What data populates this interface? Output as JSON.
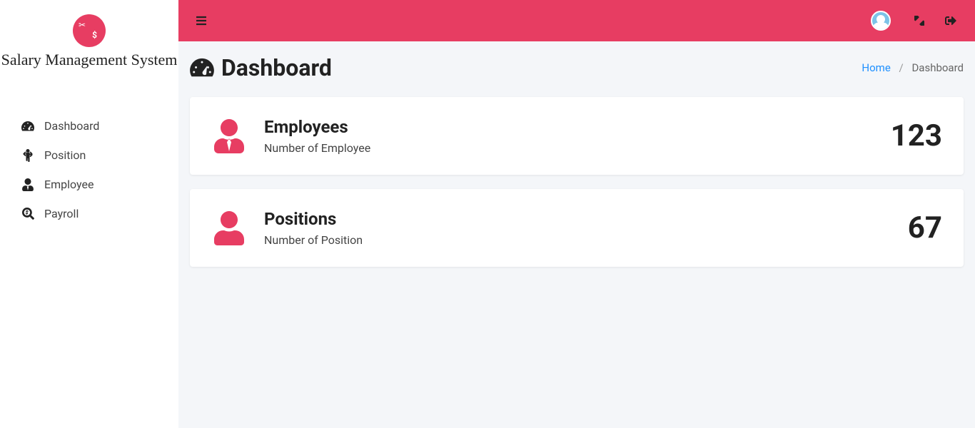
{
  "brand": {
    "name": "Salary Management System"
  },
  "sidebar": {
    "items": [
      {
        "label": "Dashboard"
      },
      {
        "label": "Position"
      },
      {
        "label": "Employee"
      },
      {
        "label": "Payroll"
      }
    ]
  },
  "header": {
    "title": "Dashboard",
    "breadcrumb": {
      "home": "Home",
      "current": "Dashboard"
    }
  },
  "cards": [
    {
      "title": "Employees",
      "subtitle": "Number of Employee",
      "value": "123"
    },
    {
      "title": "Positions",
      "subtitle": "Number of Position",
      "value": "67"
    }
  ]
}
